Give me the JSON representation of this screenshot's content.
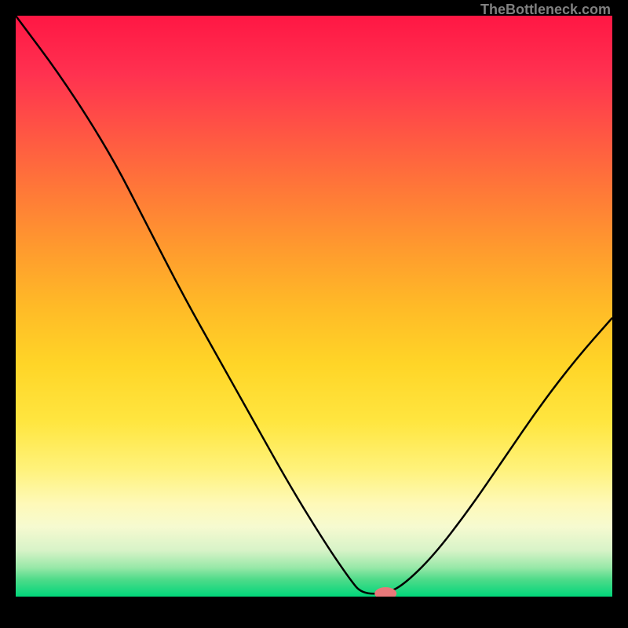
{
  "attribution": "TheBottleneck.com",
  "chart_data": {
    "type": "line",
    "title": "",
    "xlabel": "",
    "ylabel": "",
    "xlim": [
      0,
      100
    ],
    "ylim": [
      0,
      100
    ],
    "curve_points": [
      {
        "x": 0,
        "y": 100
      },
      {
        "x": 8,
        "y": 89
      },
      {
        "x": 16,
        "y": 76
      },
      {
        "x": 22,
        "y": 64
      },
      {
        "x": 28,
        "y": 52
      },
      {
        "x": 34,
        "y": 41
      },
      {
        "x": 40,
        "y": 30
      },
      {
        "x": 46,
        "y": 19
      },
      {
        "x": 52,
        "y": 9
      },
      {
        "x": 56,
        "y": 3
      },
      {
        "x": 58,
        "y": 0.5
      },
      {
        "x": 62,
        "y": 0.5
      },
      {
        "x": 65,
        "y": 2
      },
      {
        "x": 70,
        "y": 7
      },
      {
        "x": 76,
        "y": 15
      },
      {
        "x": 82,
        "y": 24
      },
      {
        "x": 88,
        "y": 33
      },
      {
        "x": 94,
        "y": 41
      },
      {
        "x": 100,
        "y": 48
      }
    ],
    "marker": {
      "x": 62,
      "y": 0,
      "color": "#e8787a"
    },
    "gradient_stops": [
      {
        "offset": 0,
        "color": "#ff1744"
      },
      {
        "offset": 10,
        "color": "#ff3150"
      },
      {
        "offset": 20,
        "color": "#ff5544"
      },
      {
        "offset": 30,
        "color": "#ff7838"
      },
      {
        "offset": 40,
        "color": "#ff9a2e"
      },
      {
        "offset": 50,
        "color": "#ffba27"
      },
      {
        "offset": 60,
        "color": "#ffd527"
      },
      {
        "offset": 70,
        "color": "#ffe640"
      },
      {
        "offset": 78,
        "color": "#fff27a"
      },
      {
        "offset": 84,
        "color": "#fef9b8"
      },
      {
        "offset": 88,
        "color": "#f6fad0"
      },
      {
        "offset": 92,
        "color": "#d8f3c8"
      },
      {
        "offset": 95,
        "color": "#98e8a8"
      },
      {
        "offset": 97,
        "color": "#50db8a"
      },
      {
        "offset": 100,
        "color": "#00d67a"
      }
    ]
  }
}
